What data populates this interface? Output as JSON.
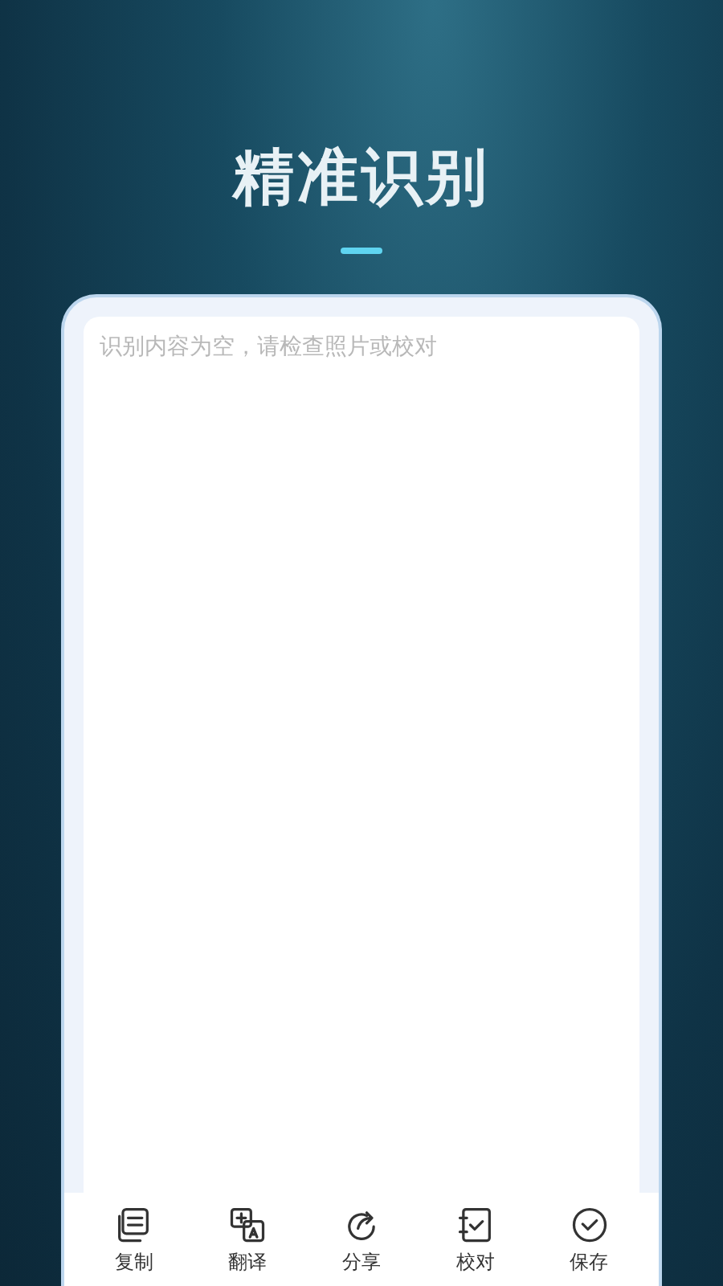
{
  "header": {
    "title": "精准识别"
  },
  "result": {
    "placeholder": "识别内容为空，请检查照片或校对"
  },
  "toolbar": [
    {
      "kind": "copy",
      "label": "复制"
    },
    {
      "kind": "translate",
      "label": "翻译"
    },
    {
      "kind": "share",
      "label": "分享"
    },
    {
      "kind": "proofread",
      "label": "校对"
    },
    {
      "kind": "save",
      "label": "保存"
    }
  ]
}
